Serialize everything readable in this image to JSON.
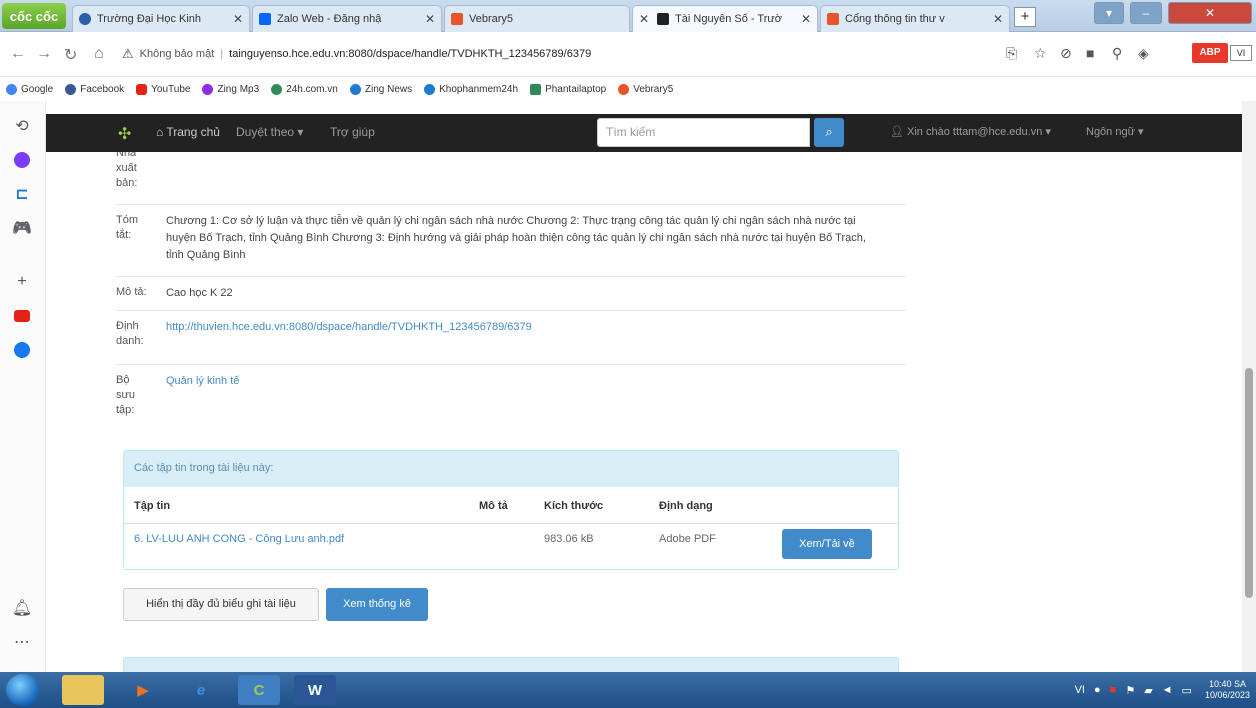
{
  "browser": {
    "brand": "cốc cốc",
    "tabs": [
      {
        "label": "Trường Đại Học Kinh",
        "color": "#2b5fa8",
        "active": false
      },
      {
        "label": "Zalo Web - Đăng nhậ",
        "color": "#0068ff",
        "active": false
      },
      {
        "label": "Vebrary5",
        "color": "#e8542b",
        "active": false
      },
      {
        "label": "Tài Nguyên Số - Trườ",
        "color": "#222222",
        "active": true
      },
      {
        "label": "Cổng thông tin thư v",
        "color": "#e8542b",
        "active": false
      }
    ],
    "new_tab": "+",
    "security_label": "Không bảo mật",
    "url": "tainguyenso.hce.edu.vn:8080/dspace/handle/TVDHKTH_123456789/6379",
    "extension_label": "ABP",
    "language_badge": "VI",
    "bookmarks": [
      {
        "label": "Google",
        "color": "#4285f4"
      },
      {
        "label": "Facebook",
        "color": "#3b5998"
      },
      {
        "label": "YouTube",
        "color": "#e62117"
      },
      {
        "label": "Zing Mp3",
        "color": "#8e2de2"
      },
      {
        "label": "24h.com.vn",
        "color": "#2e8b57"
      },
      {
        "label": "Zing News",
        "color": "#1f7bd1"
      },
      {
        "label": "Khophanmem24h",
        "color": "#1f7bd1"
      },
      {
        "label": "Phantailaptop",
        "color": "#2e8b57"
      },
      {
        "label": "Vebrary5",
        "color": "#e8542b"
      }
    ]
  },
  "site": {
    "nav": {
      "home": "Trang chủ",
      "browse": "Duyệt theo ▾",
      "help": "Trợ giúp",
      "search_placeholder": "Tìm kiếm",
      "greeting": "Xin chào tttam@hce.edu.vn ▾",
      "language": "Ngôn ngữ ▾"
    },
    "metadata": {
      "publisher_label": "Nhà xuất bản:",
      "abstract_label": "Tóm tắt:",
      "abstract_value": "Chương 1: Cơ sở lý luận và thực tiễn về quản lý chi ngân sách nhà nước Chương 2: Thực trạng công tác quản lý chi ngân sách nhà nước tại huyện Bố Trạch, tỉnh Quảng Bình Chương 3: Định hướng và giải pháp hoàn thiện công tác quản lý chi ngân sách nhà nước tại huyện Bố Trạch, tỉnh Quảng Bình",
      "description_label": "Mô tả:",
      "description_value": "Cao học K 22",
      "identifier_label": "Định danh:",
      "identifier_value": "http://thuvien.hce.edu.vn:8080/dspace/handle/TVDHKTH_123456789/6379",
      "collection_label": "Bộ sưu tập:",
      "collection_value": "Quản lý kinh tế"
    },
    "files_panel": {
      "heading": "Các tập tin trong tài liệu này:",
      "columns": {
        "file": "Tập tin",
        "description": "Mô tả",
        "size": "Kích thước",
        "format": "Định dạng"
      },
      "rows": [
        {
          "file": "6. LV-LUU ANH CONG - Công Lưu anh.pdf",
          "description": "",
          "size": "983.06 kB",
          "format": "Adobe PDF",
          "action": "Xem/Tải về"
        }
      ]
    },
    "buttons": {
      "full_record": "Hiển thị đầy đủ biểu ghi tài liệu",
      "stats": "Xem thống kê"
    }
  },
  "taskbar": {
    "clock_time": "10:40 SA",
    "clock_date": "10/06/2023",
    "lang": "VI"
  }
}
